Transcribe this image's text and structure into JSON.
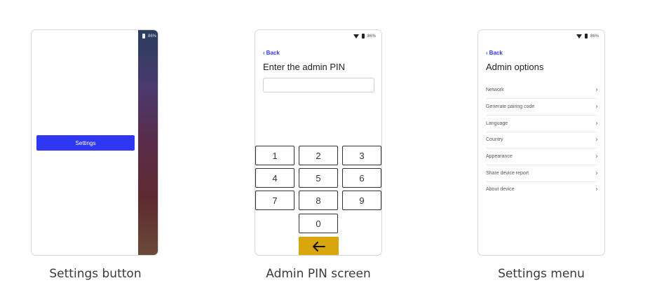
{
  "status": {
    "battery": "86%"
  },
  "screens": [
    {
      "settings_button": "Settings",
      "caption": "Settings button"
    },
    {
      "back": "Back",
      "title": "Enter the admin PIN",
      "keys": [
        "1",
        "2",
        "3",
        "4",
        "5",
        "6",
        "7",
        "8",
        "9",
        "0"
      ],
      "caption": "Admin PIN screen"
    },
    {
      "back": "Back",
      "title": "Admin options",
      "menu": [
        "Network",
        "Generate pairing code",
        "Language",
        "Country",
        "Appearance",
        "Share device report",
        "About device"
      ],
      "caption": "Settings menu"
    }
  ],
  "icons": {
    "back": "chevron-left-icon",
    "menu_arrow": "chevron-right-icon",
    "backspace": "arrow-left-icon"
  },
  "colors": {
    "accent": "#2f37f2",
    "backspace_key": "#d9a60d"
  }
}
